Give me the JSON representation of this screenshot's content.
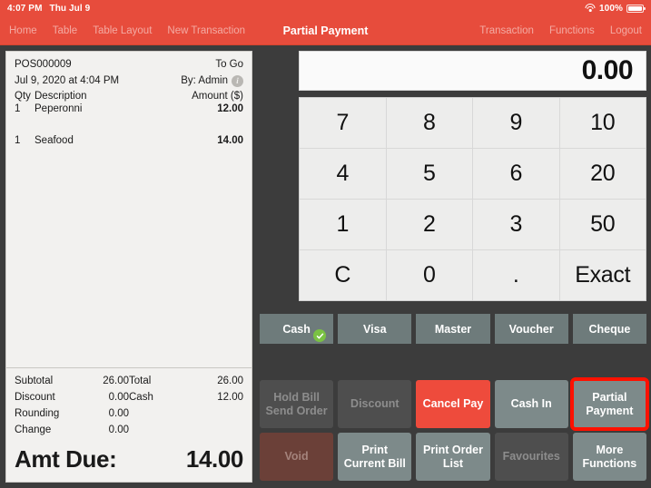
{
  "status_bar": {
    "time": "4:07 PM",
    "date": "Thu Jul 9",
    "battery_percent": "100%",
    "wifi_icon": "wifi-icon",
    "battery_icon": "battery-icon"
  },
  "nav": {
    "title": "Partial Payment",
    "left_items": [
      "Home",
      "Table",
      "Table Layout",
      "New Transaction"
    ],
    "right_items": [
      "Transaction",
      "Functions",
      "Logout"
    ]
  },
  "receipt": {
    "order_id": "POS000009",
    "order_type": "To Go",
    "datetime": "Jul 9, 2020 at 4:04 PM",
    "cashier": "By: Admin",
    "info_icon": "info-icon",
    "info_glyph": "i",
    "columns": {
      "qty": "Qty",
      "description": "Description",
      "amount": "Amount ($)"
    },
    "items": [
      {
        "qty": "1",
        "description": "Peperonni",
        "amount": "12.00"
      },
      {
        "qty": "1",
        "description": "Seafood",
        "amount": "14.00"
      }
    ],
    "totals_left": [
      {
        "label": "Subtotal",
        "value": "26.00"
      },
      {
        "label": "Discount",
        "value": "0.00"
      },
      {
        "label": "Rounding",
        "value": "0.00"
      },
      {
        "label": "Change",
        "value": "0.00"
      }
    ],
    "totals_right": [
      {
        "label": "Total",
        "value": "26.00"
      },
      {
        "label": "Cash",
        "value": "12.00"
      }
    ],
    "amount_due_label": "Amt Due:",
    "amount_due_value": "14.00"
  },
  "keypad": {
    "display_value": "0.00",
    "keys": [
      "7",
      "8",
      "9",
      "10",
      "4",
      "5",
      "6",
      "20",
      "1",
      "2",
      "3",
      "50",
      "C",
      "0",
      ".",
      "Exact"
    ]
  },
  "payment_methods": [
    {
      "label": "Cash",
      "selected": true,
      "check_icon": "check-icon"
    },
    {
      "label": "Visa",
      "selected": false
    },
    {
      "label": "Master",
      "selected": false
    },
    {
      "label": "Voucher",
      "selected": false
    },
    {
      "label": "Cheque",
      "selected": false
    }
  ],
  "actions": [
    {
      "label": "Hold Bill\nSend Order",
      "state": "disabled"
    },
    {
      "label": "Discount",
      "state": "disabled"
    },
    {
      "label": "Cancel Pay",
      "state": "danger"
    },
    {
      "label": "Cash In",
      "state": "normal"
    },
    {
      "label": "Partial\nPayment",
      "state": "normal",
      "highlighted": true
    },
    {
      "label": "Void",
      "state": "void"
    },
    {
      "label": "Print\nCurrent Bill",
      "state": "normal"
    },
    {
      "label": "Print Order\nList",
      "state": "normal"
    },
    {
      "label": "Favourites",
      "state": "disabled"
    },
    {
      "label": "More\nFunctions",
      "state": "normal"
    }
  ],
  "colors": {
    "brand_red": "#e74c3c",
    "highlight_red": "#ff1100",
    "danger_red": "#ee4b3c",
    "app_background": "#3c3c3c",
    "button_teal": "#7d8a8a",
    "pay_button": "#6e7b7b",
    "disabled": "#4e4e4e",
    "void": "#6b4038",
    "check_green": "#7ac143",
    "receipt_paper": "#f2f1ef",
    "key_face": "#ededec"
  }
}
